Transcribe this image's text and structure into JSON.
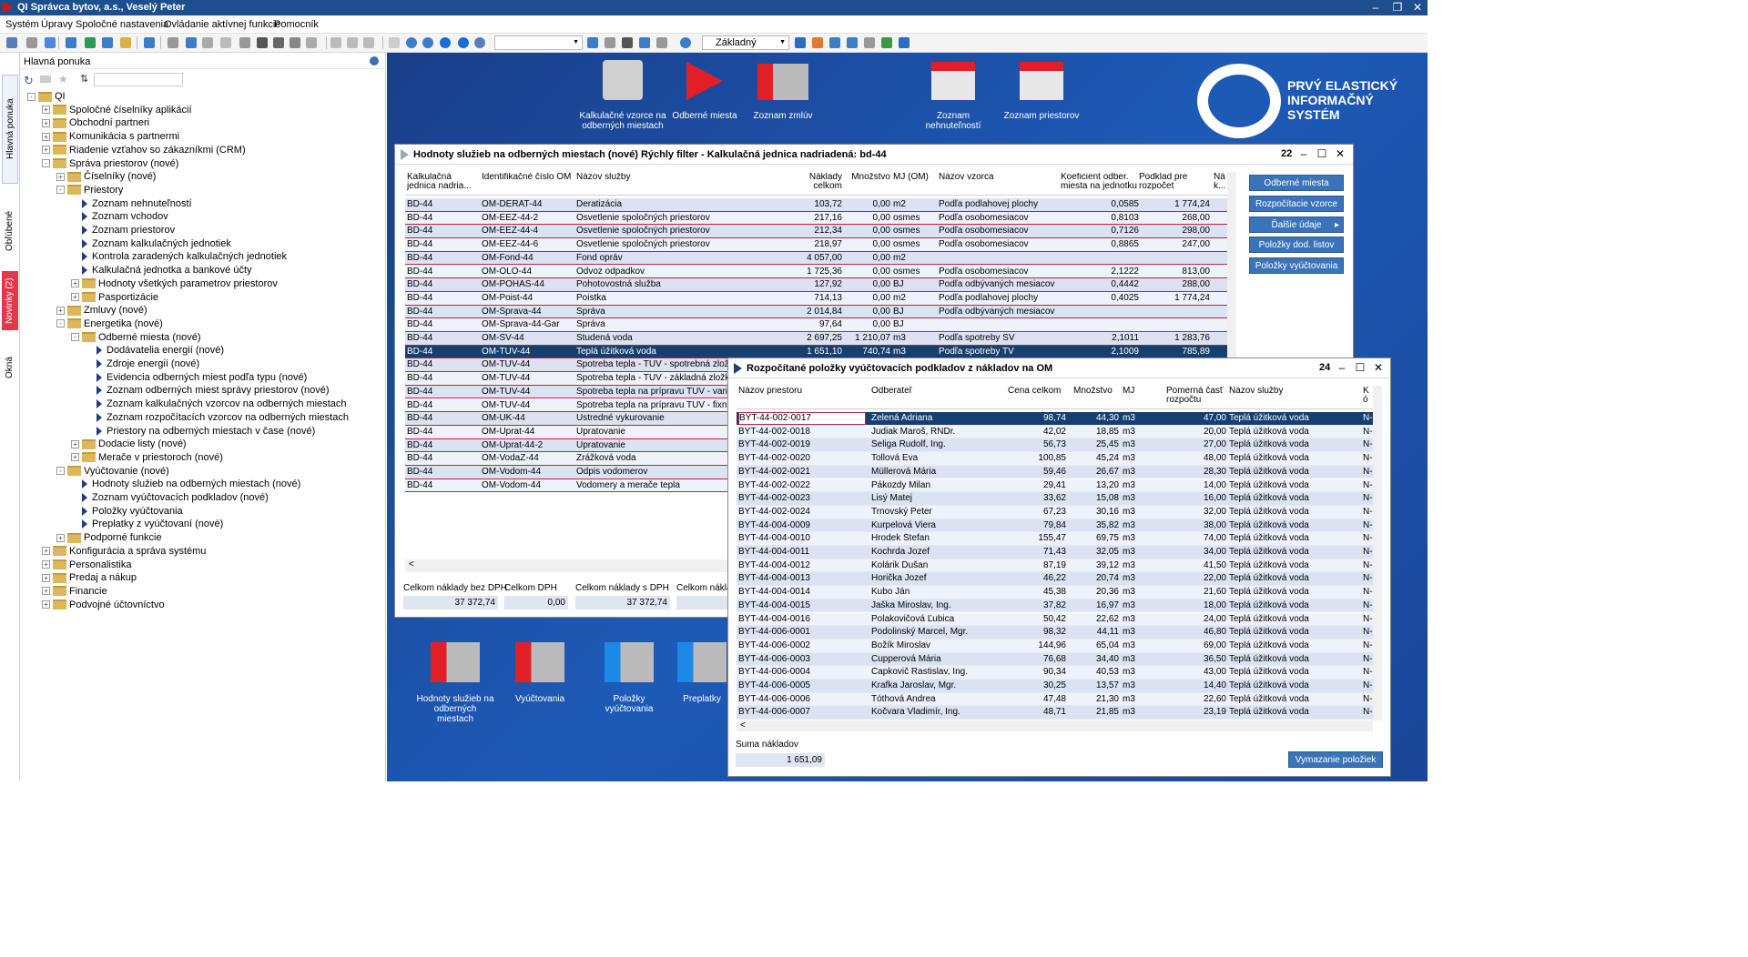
{
  "titlebar": {
    "title": "QI  Správca bytov, a.s., Veselý Peter"
  },
  "menu": [
    "Systém",
    "Úpravy",
    "Spoločné nastavenia",
    "Ovládanie aktívnej funkcie",
    "Pomocník"
  ],
  "toolbar": {
    "view_combo": "Základný",
    "empty_combo": ""
  },
  "vtabs": {
    "main": "Hlavná ponuka",
    "fav": "Obľúbené",
    "news": "Novinky (2)",
    "windows": "Okná"
  },
  "leftpanel": {
    "title": "Hlavná ponuka",
    "search_placeholder": "",
    "tree": [
      {
        "label": "QI",
        "level": 0,
        "type": "folder",
        "exp": "-"
      },
      {
        "label": "Spoločné číselníky aplikácií",
        "level": 1,
        "type": "folder",
        "exp": "+"
      },
      {
        "label": "Obchodní partneri",
        "level": 1,
        "type": "folder",
        "exp": "+"
      },
      {
        "label": "Komunikácia s partnermi",
        "level": 1,
        "type": "folder",
        "exp": "+"
      },
      {
        "label": "Riadenie vzťahov so zákazníkmi (CRM)",
        "level": 1,
        "type": "folder",
        "exp": "+"
      },
      {
        "label": "Správa priestorov (nové)",
        "level": 1,
        "type": "folder",
        "exp": "-"
      },
      {
        "label": "Číselníky (nové)",
        "level": 2,
        "type": "folder",
        "exp": "+"
      },
      {
        "label": "Priestory",
        "level": 2,
        "type": "folder",
        "exp": "-"
      },
      {
        "label": "Zoznam nehnuteľností",
        "level": 3,
        "type": "leaf"
      },
      {
        "label": "Zoznam vchodov",
        "level": 3,
        "type": "leaf"
      },
      {
        "label": "Zoznam priestorov",
        "level": 3,
        "type": "leaf"
      },
      {
        "label": "Zoznam kalkulačných jednotiek",
        "level": 3,
        "type": "leaf"
      },
      {
        "label": "Kontrola zaradených kalkulačných jednotiek",
        "level": 3,
        "type": "leaf"
      },
      {
        "label": "Kalkulačná jednotka a bankové účty",
        "level": 3,
        "type": "leaf"
      },
      {
        "label": "Hodnoty všetkých parametrov priestorov",
        "level": 3,
        "type": "folder",
        "exp": "+"
      },
      {
        "label": "Pasportizácie",
        "level": 3,
        "type": "folder",
        "exp": "+"
      },
      {
        "label": "Zmluvy (nové)",
        "level": 2,
        "type": "folder",
        "exp": "+"
      },
      {
        "label": "Energetika (nové)",
        "level": 2,
        "type": "folder",
        "exp": "-"
      },
      {
        "label": "Odberné miesta (nové)",
        "level": 3,
        "type": "folder",
        "exp": "-"
      },
      {
        "label": "Dodávatelia energií (nové)",
        "level": 4,
        "type": "leaf"
      },
      {
        "label": "Zdroje energií (nové)",
        "level": 4,
        "type": "leaf"
      },
      {
        "label": "Evidencia odberných miest podľa typu (nové)",
        "level": 4,
        "type": "leaf"
      },
      {
        "label": "Zoznam odberných miest správy priestorov (nové)",
        "level": 4,
        "type": "leaf"
      },
      {
        "label": "Zoznam kalkulačných vzorcov na odberných miestach",
        "level": 4,
        "type": "leaf"
      },
      {
        "label": "Zoznam rozpočítacích vzorcov na odberných miestach",
        "level": 4,
        "type": "leaf"
      },
      {
        "label": "Priestory na odberných miestach v čase (nové)",
        "level": 4,
        "type": "leaf"
      },
      {
        "label": "Dodacie listy (nové)",
        "level": 3,
        "type": "folder",
        "exp": "+"
      },
      {
        "label": "Merače v priestoroch (nové)",
        "level": 3,
        "type": "folder",
        "exp": "+"
      },
      {
        "label": "Vyúčtovanie (nové)",
        "level": 2,
        "type": "folder",
        "exp": "-"
      },
      {
        "label": "Hodnoty služieb na odberných miestach (nové)",
        "level": 3,
        "type": "leaf"
      },
      {
        "label": "Zoznam vyúčtovacích podkladov (nové)",
        "level": 3,
        "type": "leaf"
      },
      {
        "label": "Položky vyúčtovania",
        "level": 3,
        "type": "leaf"
      },
      {
        "label": "Preplatky z vyúčtovaní (nové)",
        "level": 3,
        "type": "leaf"
      },
      {
        "label": "Podporné funkcie",
        "level": 2,
        "type": "folder",
        "exp": "+"
      },
      {
        "label": "Konfigurácia a správa systému",
        "level": 1,
        "type": "folder",
        "exp": "+"
      },
      {
        "label": "Personalistika",
        "level": 1,
        "type": "folder",
        "exp": "+"
      },
      {
        "label": "Predaj a nákup",
        "level": 1,
        "type": "folder",
        "exp": "+"
      },
      {
        "label": "Financie",
        "level": 1,
        "type": "folder",
        "exp": "+"
      },
      {
        "label": "Podvojné účtovníctvo",
        "level": 1,
        "type": "folder",
        "exp": "+"
      }
    ]
  },
  "desktop": {
    "top_icons": [
      {
        "label": "Kalkulačné vzorce na odberných miestach"
      },
      {
        "label": "Odberné miesta"
      },
      {
        "label": "Zoznam zmlúv"
      },
      {
        "label": "Zoznam nehnuteľností"
      },
      {
        "label": "Zoznam priestorov"
      }
    ],
    "bottom_icons": [
      {
        "label": "Hodnoty služieb na odberných miestach"
      },
      {
        "label": "Vyúčtovania"
      },
      {
        "label": "Položky vyúčtovania"
      },
      {
        "label": "Preplatky"
      }
    ],
    "logo": {
      "line1": "PRVÝ ELASTICKÝ",
      "line2": "INFORMAČNÝ",
      "line3": "SYSTÉM"
    }
  },
  "win1": {
    "title": "Hodnoty služieb na odberných miestach (nové)   Rýchly filter -  Kalkulačná jednica nadriadená: bd-44",
    "count": "22",
    "headers": [
      "Kalkulačná jednica nadria...",
      "Identifikačné číslo OM",
      "Názov služby",
      "Náklady celkom",
      "Množstvo",
      "MJ (OM)",
      "Názov vzorca",
      "Koeficient odber. miesta na jednotku",
      "Podklad pre rozpočet",
      "Ná k..."
    ],
    "rows": [
      [
        "BD-44",
        "OM-DERAT-44",
        "Deratizácia",
        "103,72",
        "0,00",
        "m2",
        "Podľa podlahovej plochy",
        "0,0585",
        "1 774,24"
      ],
      [
        "BD-44",
        "OM-EEZ-44-2",
        "Osvetlenie spoločných priestorov",
        "217,16",
        "0,00",
        "osmes",
        "Podľa osobomesiacov",
        "0,8103",
        "268,00"
      ],
      [
        "BD-44",
        "OM-EEZ-44-4",
        "Osvetlenie spoločných priestorov",
        "212,34",
        "0,00",
        "osmes",
        "Podľa osobomesiacov",
        "0,7126",
        "298,00"
      ],
      [
        "BD-44",
        "OM-EEZ-44-6",
        "Osvetlenie spoločných priestorov",
        "218,97",
        "0,00",
        "osmes",
        "Podľa osobomesiacov",
        "0,8865",
        "247,00"
      ],
      [
        "BD-44",
        "OM-Fond-44",
        "Fond opráv",
        "4 057,00",
        "0,00",
        "m2",
        "",
        "",
        ""
      ],
      [
        "BD-44",
        "OM-OLO-44",
        "Odvoz odpadkov",
        "1 725,36",
        "0,00",
        "osmes",
        "Podľa osobomesiacov",
        "2,1222",
        "813,00"
      ],
      [
        "BD-44",
        "OM-POHAS-44",
        "Pohotovostná služba",
        "127,92",
        "0,00",
        "BJ",
        "Podľa odbývaných mesiacov",
        "0,4442",
        "288,00"
      ],
      [
        "BD-44",
        "OM-Poist-44",
        "Poistka",
        "714,13",
        "0,00",
        "m2",
        "Podľa podlahovej plochy",
        "0,4025",
        "1 774,24"
      ],
      [
        "BD-44",
        "OM-Sprava-44",
        "Správa",
        "2 014,84",
        "0,00",
        "BJ",
        "Podľa odbývaných mesiacov",
        "",
        ""
      ],
      [
        "BD-44",
        "OM-Sprava-44-Gar",
        "Správa",
        "97,64",
        "0,00",
        "BJ",
        "",
        "",
        ""
      ],
      [
        "BD-44",
        "OM-SV-44",
        "Studená voda",
        "2 697,25",
        "1 210,07",
        "m3",
        "Podľa spotreby SV",
        "2,1011",
        "1 283,76"
      ],
      [
        "BD-44",
        "OM-TUV-44",
        "Teplá úžitková voda",
        "1 651,10",
        "740,74",
        "m3",
        "Podľa spotreby TV",
        "2,1009",
        "785,89"
      ],
      [
        "BD-44",
        "OM-TUV-44",
        "Spotreba tepla - TUV - spotrebná zložka",
        "",
        "",
        "",
        "",
        "",
        ""
      ],
      [
        "BD-44",
        "OM-TUV-44",
        "Spotreba tepla - TUV - základná zložka",
        "",
        "",
        "",
        "",
        "",
        ""
      ],
      [
        "BD-44",
        "OM-TUV-44",
        "Spotreba tepla na prípravu TUV - variabiln",
        "",
        "",
        "",
        "",
        "",
        ""
      ],
      [
        "BD-44",
        "OM-TUV-44",
        "Spotreba tepla na prípravu TUV -  fixná zlo",
        "",
        "",
        "",
        "",
        "",
        ""
      ],
      [
        "BD-44",
        "OM-UK-44",
        "Ustredné vykurovanie",
        "",
        "",
        "",
        "",
        "",
        ""
      ],
      [
        "BD-44",
        "OM-Uprat-44",
        "Upratovanie",
        "",
        "",
        "",
        "",
        "",
        ""
      ],
      [
        "BD-44",
        "OM-Uprat-44-2",
        "Upratovanie",
        "",
        "",
        "",
        "",
        "",
        ""
      ],
      [
        "BD-44",
        "OM-VodaZ-44",
        "Zrážková voda",
        "",
        "",
        "",
        "",
        "",
        ""
      ],
      [
        "BD-44",
        "OM-Vodom-44",
        "Odpis vodomerov",
        "",
        "",
        "",
        "",
        "",
        ""
      ],
      [
        "BD-44",
        "OM-Vodom-44",
        "Vodomery a merače tepla",
        "",
        "",
        "",
        "",
        "",
        ""
      ]
    ],
    "selected_row": 11,
    "buttons": [
      "Odberné miesta",
      "Rozpočítacie vzorce",
      "Ďalšie údaje",
      "Položky dod. listov",
      "Položky vyúčtovania"
    ],
    "sums": [
      {
        "label": "Celkom náklady bez DPH",
        "value": "37 372,74"
      },
      {
        "label": "Celkom DPH",
        "value": "0,00"
      },
      {
        "label": "Celkom náklady s DPH",
        "value": "37 372,74"
      },
      {
        "label": "Celkom náklad",
        "value": ""
      }
    ]
  },
  "win2": {
    "title": "Rozpočítané položky vyúčtovacích podkladov z nákladov na OM",
    "count": "24",
    "headers": [
      "Názov priestoru",
      "Odberateľ",
      "Cena celkom",
      "Množstvo",
      "MJ",
      "Pomerná časť rozpočtu",
      "Názov služby",
      "K ó"
    ],
    "rows": [
      [
        "BYT-44-002-0017",
        "Zelená Adriana",
        "98,74",
        "44,30",
        "m3",
        "47,00",
        "Teplá úžitková voda",
        "N-"
      ],
      [
        "BYT-44-002-0018",
        "Judiak Maroš, RNDr.",
        "42,02",
        "18,85",
        "m3",
        "20,00",
        "Teplá úžitková voda",
        "N-"
      ],
      [
        "BYT-44-002-0019",
        "Šeliga Rudolf, Ing.",
        "56,73",
        "25,45",
        "m3",
        "27,00",
        "Teplá úžitková voda",
        "N-"
      ],
      [
        "BYT-44-002-0020",
        "Tollová Eva",
        "100,85",
        "45,24",
        "m3",
        "48,00",
        "Teplá úžitková voda",
        "N-"
      ],
      [
        "BYT-44-002-0021",
        "Müllerová Mária",
        "59,46",
        "26,67",
        "m3",
        "28,30",
        "Teplá úžitková voda",
        "N-"
      ],
      [
        "BYT-44-002-0022",
        "Pákozdy Milan",
        "29,41",
        "13,20",
        "m3",
        "14,00",
        "Teplá úžitková voda",
        "N-"
      ],
      [
        "BYT-44-002-0023",
        "Lisý Matej",
        "33,62",
        "15,08",
        "m3",
        "16,00",
        "Teplá úžitková voda",
        "N-"
      ],
      [
        "BYT-44-002-0024",
        "Trnovský Peter",
        "67,23",
        "30,16",
        "m3",
        "32,00",
        "Teplá úžitková voda",
        "N-"
      ],
      [
        "BYT-44-004-0009",
        "Kurpelová Viera",
        "79,84",
        "35,82",
        "m3",
        "38,00",
        "Teplá úžitková voda",
        "N-"
      ],
      [
        "BYT-44-004-0010",
        "Hrodek Štefan",
        "155,47",
        "69,75",
        "m3",
        "74,00",
        "Teplá úžitková voda",
        "N-"
      ],
      [
        "BYT-44-004-0011",
        "Kochrda Jozef",
        "71,43",
        "32,05",
        "m3",
        "34,00",
        "Teplá úžitková voda",
        "N-"
      ],
      [
        "BYT-44-004-0012",
        "Kolárik Dušan",
        "87,19",
        "39,12",
        "m3",
        "41,50",
        "Teplá úžitková voda",
        "N-"
      ],
      [
        "BYT-44-004-0013",
        "Horička Jozef",
        "46,22",
        "20,74",
        "m3",
        "22,00",
        "Teplá úžitková voda",
        "N-"
      ],
      [
        "BYT-44-004-0014",
        "Kubo Ján",
        "45,38",
        "20,36",
        "m3",
        "21,60",
        "Teplá úžitková voda",
        "N-"
      ],
      [
        "BYT-44-004-0015",
        "Jaška Miroslav, Ing.",
        "37,82",
        "16,97",
        "m3",
        "18,00",
        "Teplá úžitková voda",
        "N-"
      ],
      [
        "BYT-44-004-0016",
        "Polakovičová Ľubica",
        "50,42",
        "22,62",
        "m3",
        "24,00",
        "Teplá úžitková voda",
        "N-"
      ],
      [
        "BYT-44-006-0001",
        "Podolinský Marcel, Mgr.",
        "98,32",
        "44,11",
        "m3",
        "46,80",
        "Teplá úžitková voda",
        "N-"
      ],
      [
        "BYT-44-006-0002",
        "Božík Miroslav",
        "144,96",
        "65,04",
        "m3",
        "69,00",
        "Teplá úžitková voda",
        "N-"
      ],
      [
        "BYT-44-006-0003",
        "Cupperová Mária",
        "76,68",
        "34,40",
        "m3",
        "36,50",
        "Teplá úžitková voda",
        "N-"
      ],
      [
        "BYT-44-006-0004",
        "Čapkovič Rastislav, Ing.",
        "90,34",
        "40,53",
        "m3",
        "43,00",
        "Teplá úžitková voda",
        "N-"
      ],
      [
        "BYT-44-006-0005",
        "Krafka Jaroslav, Mgr.",
        "30,25",
        "13,57",
        "m3",
        "14,40",
        "Teplá úžitková voda",
        "N-"
      ],
      [
        "BYT-44-006-0006",
        "Tóthová Andrea",
        "47,48",
        "21,30",
        "m3",
        "22,60",
        "Teplá úžitková voda",
        "N-"
      ],
      [
        "BYT-44-006-0007",
        "Kočvara Vladimír, Ing.",
        "48,71",
        "21,85",
        "m3",
        "23,19",
        "Teplá úžitková voda",
        "N-"
      ]
    ],
    "selected_row": 0,
    "sum_label": "Suma nákladov",
    "sum_value": "1 651,09",
    "button": "Vymazanie položiek"
  }
}
